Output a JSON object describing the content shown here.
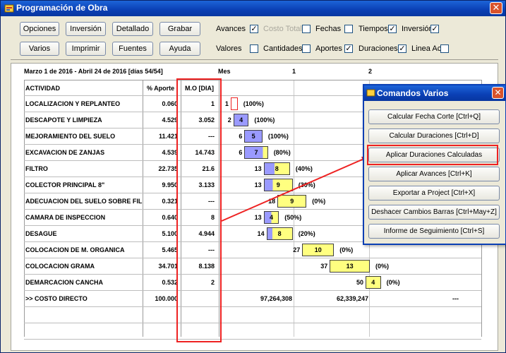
{
  "window": {
    "title": "Programación de Obra",
    "close": "✕"
  },
  "toolbar": {
    "buttons_row1": [
      "Opciones",
      "Inversión",
      "Detallado",
      "Grabar"
    ],
    "buttons_row2": [
      "Varios",
      "Imprimir",
      "Fuentes",
      "Ayuda"
    ],
    "row1_label": "Avances",
    "row1_options": [
      {
        "label": "Costo Total",
        "checked": true,
        "disabled": true
      },
      {
        "label": "Fechas",
        "checked": false,
        "disabled": false
      },
      {
        "label": "Tiempos",
        "checked": false,
        "disabled": false
      },
      {
        "label": "Inversión",
        "checked": true,
        "disabled": false
      }
    ],
    "row2_label": "Valores",
    "row2_options": [
      {
        "label": "Cantidades",
        "checked": false
      },
      {
        "label": "Aportes",
        "checked": false
      },
      {
        "label": "Duraciones",
        "checked": true
      },
      {
        "label": "Linea Act",
        "checked": true
      }
    ],
    "avances_checked": true,
    "valores_checked": false
  },
  "sheet": {
    "period": "Marzo 1 de 2016 - Abril 24 de 2016 [días 54/54]",
    "month_label": "Mes",
    "month_numbers": [
      "1",
      "2"
    ],
    "headers": {
      "activity": "ACTIVIDAD",
      "pct": "% Aporte",
      "mo": "M.O [DIA]"
    },
    "rows": [
      {
        "activity": "LOCALIZACION Y REPLANTEO",
        "pct": "0.060",
        "mo": "1",
        "start": "1",
        "duration": "",
        "progress": "(100%)"
      },
      {
        "activity": "DESCAPOTE Y LIMPIEZA",
        "pct": "4.529",
        "mo": "3.052",
        "start": "2",
        "duration": "4",
        "progress": "(100%)"
      },
      {
        "activity": "MEJORAMIENTO DEL SUELO",
        "pct": "11.421",
        "mo": "---",
        "start": "6",
        "duration": "5",
        "progress": "(100%)"
      },
      {
        "activity": "EXCAVACION DE ZANJAS",
        "pct": "4.539",
        "mo": "14.743",
        "start": "6",
        "duration": "7",
        "progress": "(80%)"
      },
      {
        "activity": "FILTRO",
        "pct": "22.735",
        "mo": "21.6",
        "start": "13",
        "duration": "8",
        "progress": "(40%)"
      },
      {
        "activity": "COLECTOR PRINCIPAL 8\"",
        "pct": "9.950",
        "mo": "3.133",
        "start": "13",
        "duration": "9",
        "progress": "(30%)"
      },
      {
        "activity": "ADECUACION DEL SUELO SOBRE FIL",
        "pct": "0.321",
        "mo": "---",
        "start": "18",
        "duration": "9",
        "progress": "(0%)"
      },
      {
        "activity": "CAMARA DE INSPECCION",
        "pct": "0.640",
        "mo": "8",
        "start": "13",
        "duration": "4",
        "progress": "(50%)"
      },
      {
        "activity": "DESAGUE",
        "pct": "5.100",
        "mo": "4.944",
        "start": "14",
        "duration": "8",
        "progress": "(20%)"
      },
      {
        "activity": "COLOCACION DE M. ORGANICA",
        "pct": "5.465",
        "mo": "---",
        "start": "27",
        "duration": "10",
        "progress": "(0%)"
      },
      {
        "activity": "COLOCACION GRAMA",
        "pct": "34.701",
        "mo": "8.138",
        "start": "37",
        "duration": "13",
        "progress": "(0%)"
      },
      {
        "activity": "DEMARCACION CANCHA",
        "pct": "0.532",
        "mo": "2",
        "start": "50",
        "duration": "4",
        "progress": "(0%)"
      }
    ],
    "total": {
      "label": ">> COSTO DIRECTO",
      "pct": "100.000",
      "month1": "97,264,308",
      "month2": "62,339,247",
      "month3": "---"
    }
  },
  "popup": {
    "title": "Comandos Varios",
    "close": "✕",
    "buttons": [
      "Calcular Fecha Corte [Ctrl+Q]",
      "Calcular Duraciones [Ctrl+D]",
      "Aplicar Duraciones Calculadas",
      "Aplicar Avances [Ctrl+K]",
      "Exportar a Project [Ctrl+X]",
      "Deshacer Cambios Barras [Ctrl+May+Z]",
      "Informe de Seguimiento [Ctrl+S]"
    ]
  },
  "colors": {
    "bar_done": "#9a9aff",
    "bar_pending": "#ffff80",
    "highlight": "#ee2222",
    "title_bar": "#0a3fb4"
  }
}
